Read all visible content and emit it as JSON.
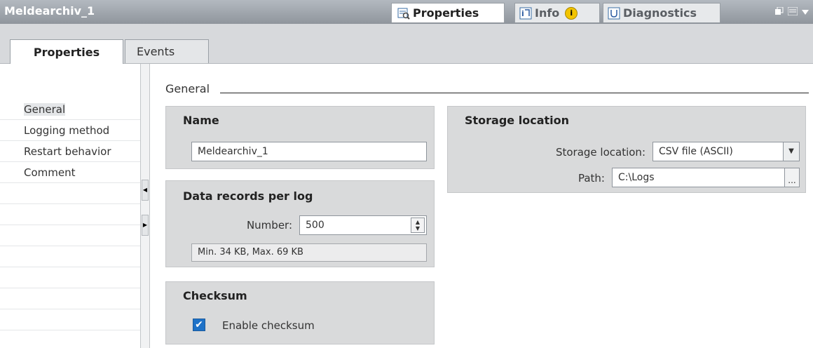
{
  "window": {
    "title": "Meldearchiv_1"
  },
  "top_tabs": {
    "properties": "Properties",
    "info": "Info",
    "info_badge": "i",
    "diagnostics": "Diagnostics"
  },
  "sub_tabs": {
    "properties": "Properties",
    "events": "Events"
  },
  "nav": {
    "items": [
      "General",
      "Logging method",
      "Restart behavior",
      "Comment"
    ],
    "selected": "General"
  },
  "section": {
    "title": "General"
  },
  "name_group": {
    "title": "Name",
    "value": "Meldearchiv_1"
  },
  "records_group": {
    "title": "Data records per log",
    "number_label": "Number:",
    "number_value": "500",
    "size_info": "Min. 34 KB, Max. 69 KB"
  },
  "checksum_group": {
    "title": "Checksum",
    "checkbox_label": "Enable checksum",
    "checked": true
  },
  "storage_group": {
    "title": "Storage location",
    "location_label": "Storage location:",
    "location_value": "CSV file (ASCII)",
    "path_label": "Path:",
    "path_value": "C:\\Logs",
    "browse_label": "..."
  },
  "colors": {
    "titlebar": "#999fa5",
    "group_bg": "#d9dadb",
    "checkbox": "#1e72c8"
  }
}
